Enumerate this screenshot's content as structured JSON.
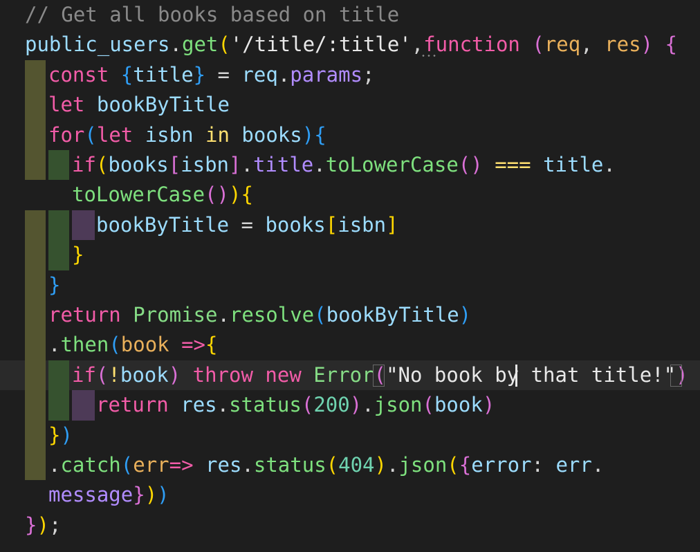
{
  "editor": {
    "language": "javascript",
    "theme_colors": {
      "background": "#1e1e1e",
      "keyword": "#f25ca8",
      "identifier": "#9cdcfe",
      "function": "#7ee07e",
      "parameter": "#e9b05b",
      "comment": "#8a8a8a",
      "number": "#6fd3b0"
    },
    "lines": [
      "// Get all books based on title",
      "public_users.get('/title/:title',function (req, res) {",
      "const {title} = req.params;",
      "let bookByTitle",
      "for(let isbn in books){",
      "if(books[isbn].title.toLowerCase() === title.",
      "toLowerCase()){",
      "bookByTitle = books[isbn]",
      "}",
      "}",
      "return Promise.resolve(bookByTitle)",
      ".then(book =>{",
      "if(!book) throw new Error(\"No book by that title!\")",
      "return res.status(200).json(book)",
      "})",
      ".catch(err=> res.status(404).json({error: err.",
      "message}))",
      "});"
    ]
  }
}
